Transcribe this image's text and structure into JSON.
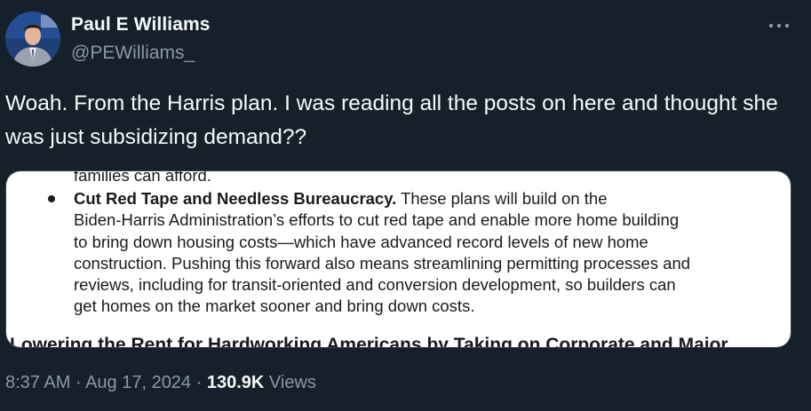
{
  "author": {
    "display_name": "Paul E Williams",
    "handle": "@PEWilliams_",
    "avatar_icon": "profile-photo"
  },
  "more_icon": "more-horizontal-icon",
  "tweet": {
    "text": "Woah. From the Harris plan. I was reading all the posts on here and thought she was just subsidizing demand??"
  },
  "media": {
    "cut_top_line": "families can afford.",
    "bullet_title": "Cut Red Tape and Needless Bureaucracy.",
    "bullet_lines": [
      " These plans will build on the",
      "Biden-Harris Administration’s efforts to cut red tape and enable more home building",
      "to bring down housing costs—which have advanced record levels of new home",
      "construction. Pushing this forward also means streamlining permitting processes and",
      "reviews, including for transit-oriented and conversion development, so builders can",
      "get homes on the market sooner and bring down costs."
    ],
    "cut_bottom_heading": "Lowering the Rent for Hardworking Americans by Taking on Corporate and Major"
  },
  "meta": {
    "time": "8:37 AM",
    "separator": " · ",
    "date": "Aug 17, 2024",
    "views_count": "130.9K",
    "views_label": " Views"
  },
  "colors": {
    "background": "#15202b",
    "primary_text": "#f7f9f9",
    "secondary_text": "#8b98a5",
    "border": "#38444d"
  }
}
